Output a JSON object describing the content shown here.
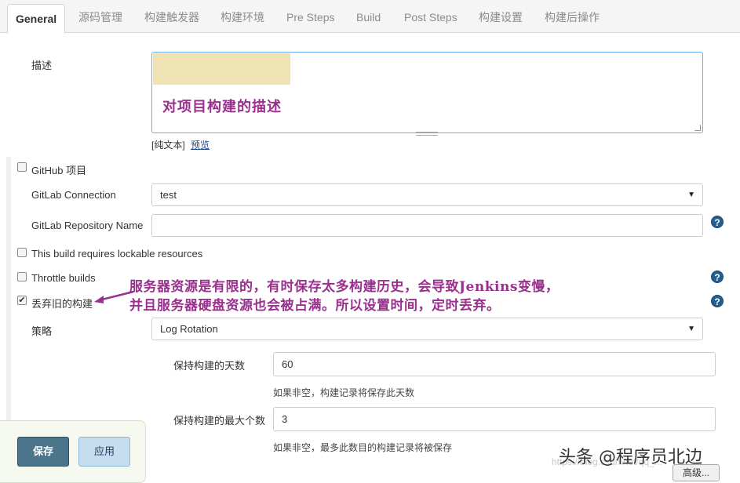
{
  "tabs": [
    {
      "label": "General",
      "active": true
    },
    {
      "label": "源码管理"
    },
    {
      "label": "构建触发器"
    },
    {
      "label": "构建环境"
    },
    {
      "label": "Pre Steps"
    },
    {
      "label": "Build"
    },
    {
      "label": "Post Steps"
    },
    {
      "label": "构建设置"
    },
    {
      "label": "构建后操作"
    }
  ],
  "description": {
    "label": "描述",
    "value": "对项目构建的描述",
    "plain_text": "[纯文本]",
    "preview": "预览"
  },
  "github_project": {
    "label": "GitHub 项目",
    "checked": false
  },
  "gitlab_connection": {
    "label": "GitLab Connection",
    "value": "test"
  },
  "gitlab_repo": {
    "label": "GitLab Repository Name",
    "value": ""
  },
  "lockable": {
    "label": "This build requires lockable resources",
    "checked": false
  },
  "throttle": {
    "label": "Throttle builds",
    "checked": false
  },
  "discard_old": {
    "label": "丢弃旧的构建",
    "checked": true,
    "check_mark": "✔"
  },
  "annotation": {
    "line1": "服务器资源是有限的，有时保存太多构建历史，会导致Jenkins变慢，",
    "line2": "并且服务器硬盘资源也会被占满。所以设置时间，定时丢弃。",
    "color": "#9a2f8e"
  },
  "strategy": {
    "label": "策略",
    "value": "Log Rotation"
  },
  "days_to_keep": {
    "label": "保持构建的天数",
    "value": "60",
    "hint": "如果非空，构建记录将保存此天数"
  },
  "max_builds": {
    "label": "保持构建的最大个数",
    "value": "3",
    "hint": "如果非空，最多此数目的构建记录将被保存"
  },
  "buttons": {
    "save": "保存",
    "apply": "应用",
    "advanced": "高级..."
  },
  "help_glyph": "?",
  "dropdown_glyph": "▼",
  "watermark": {
    "text": "头条 @程序员北边",
    "faint": "https://blog.csdn.net/qq_..."
  },
  "colors": {
    "accent": "#4b758b",
    "help": "#245d8e"
  }
}
